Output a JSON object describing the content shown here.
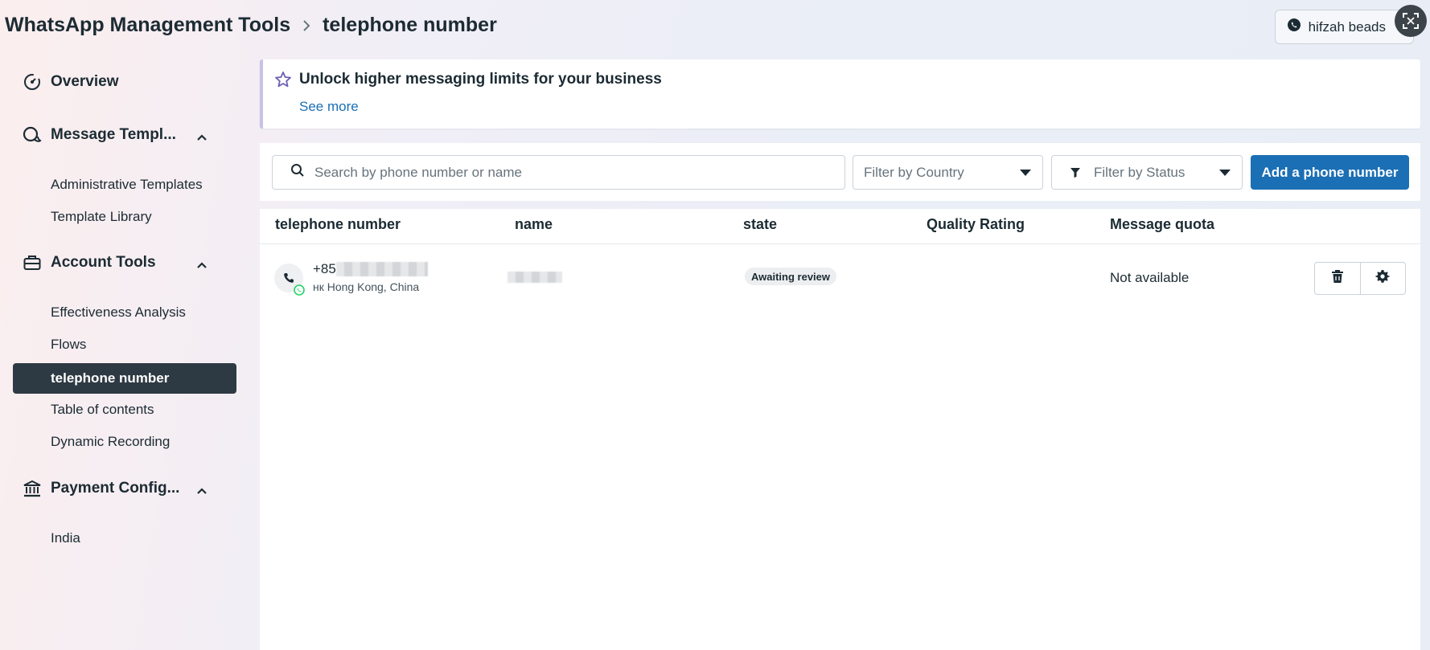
{
  "header": {
    "app_title": "WhatsApp Management Tools",
    "page_title": "telephone number",
    "account_name": "hifzah beads"
  },
  "sidebar": {
    "overview": "Overview",
    "message_templates": {
      "label": "Message Templ...",
      "items": [
        "Administrative Templates",
        "Template Library"
      ]
    },
    "account_tools": {
      "label": "Account Tools",
      "items": [
        "Effectiveness Analysis",
        "Flows",
        "telephone number",
        "Table of contents",
        "Dynamic Recording"
      ],
      "active": "telephone number"
    },
    "payment_config": {
      "label": "Payment Config...",
      "items": [
        "India"
      ]
    }
  },
  "banner": {
    "title": "Unlock higher messaging limits for your business",
    "link": "See more"
  },
  "toolbar": {
    "search_placeholder": "Search by phone number or name",
    "filter_country": "Filter by Country",
    "filter_status": "Filter by Status",
    "add_button": "Add a phone number"
  },
  "table": {
    "headers": {
      "phone": "telephone number",
      "name": "name",
      "state": "state",
      "quality": "Quality Rating",
      "quota": "Message quota"
    },
    "rows": [
      {
        "phone_prefix": "+85",
        "country": "нк Hong Kong, China",
        "state": "Awaiting review",
        "quota": "Not available"
      }
    ]
  },
  "colors": {
    "primary": "#1b6fb5",
    "active_nav": "#2e3a43",
    "whatsapp_green": "#25d366",
    "text": "#1c2b33"
  }
}
